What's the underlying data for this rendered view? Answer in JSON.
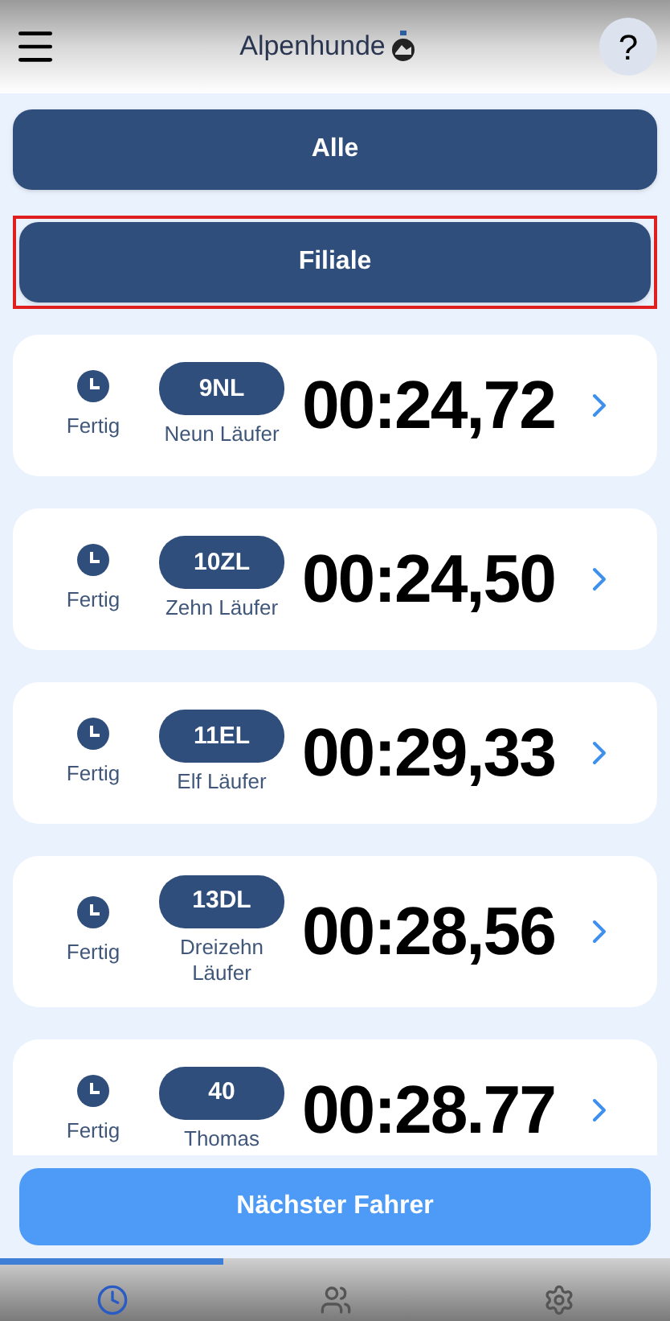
{
  "header": {
    "title": "Alpenhunde",
    "help": "?"
  },
  "filters": [
    {
      "label": "Alle",
      "highlighted": false
    },
    {
      "label": "Filiale",
      "highlighted": true
    }
  ],
  "runs": [
    {
      "status": "Fertig",
      "code": "9NL",
      "name": "Neun Läufer",
      "time": "00:24,72"
    },
    {
      "status": "Fertig",
      "code": "10ZL",
      "name": "Zehn Läufer",
      "time": "00:24,50"
    },
    {
      "status": "Fertig",
      "code": "11EL",
      "name": "Elf Läufer",
      "time": "00:29,33"
    },
    {
      "status": "Fertig",
      "code": "13DL",
      "name": "Dreizehn Läufer",
      "time": "00:28,56"
    },
    {
      "status": "Fertig",
      "code": "40",
      "name": "Thomas",
      "time": "00:28.77"
    }
  ],
  "next_button": "Nächster Fahrer",
  "nav": [
    {
      "kind": "timer",
      "selected": true
    },
    {
      "kind": "people",
      "selected": false
    },
    {
      "kind": "settings",
      "selected": false
    }
  ]
}
